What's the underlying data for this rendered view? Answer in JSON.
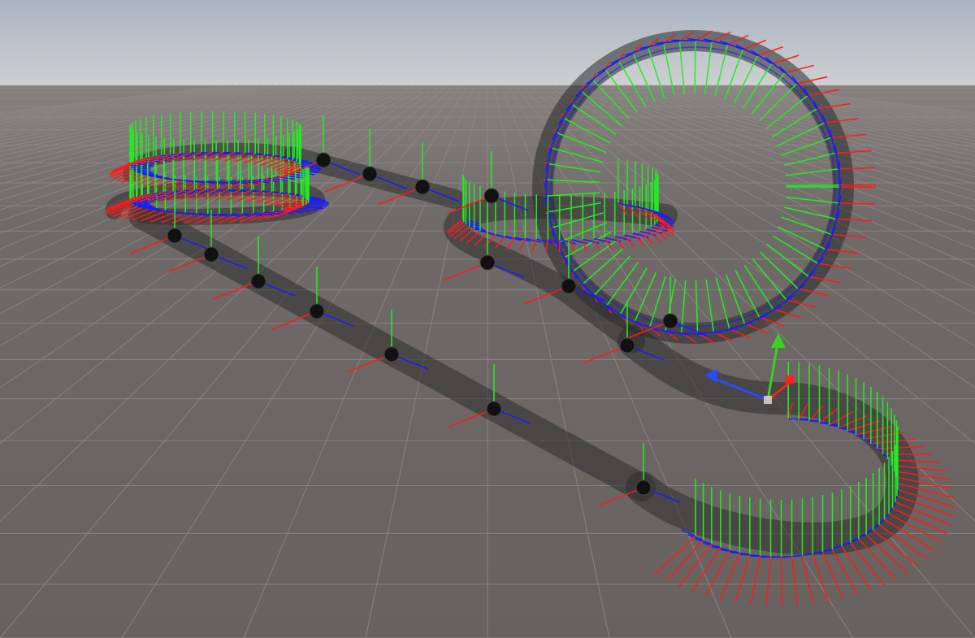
{
  "scene": {
    "sky_top": "#aab4c2",
    "horizon": "#c9ccce",
    "ground": "#6b6664",
    "grid_color": "#8c8785",
    "track_color": "#3a3a3a",
    "node_color": "#111111",
    "axis_colors": {
      "x": "#ff1a1a",
      "y": "#22ee22",
      "z": "#1a1aff"
    },
    "selected_handle_color": "#3bd11f"
  },
  "gizmos": {
    "transform_handle": "move-tool-gizmo",
    "control_point": "spline-node-icon"
  }
}
